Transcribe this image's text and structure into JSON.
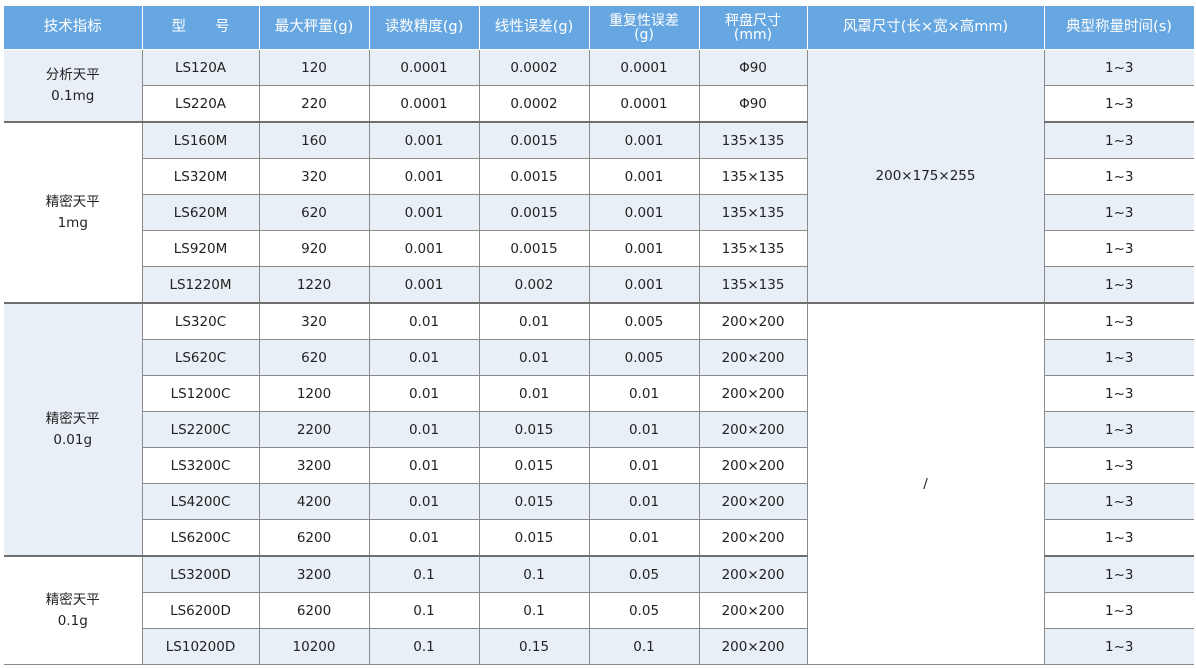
{
  "header": {
    "spec": "技术指标",
    "model": "型　　号",
    "max_capacity": "最大秤量(g)",
    "readability": "读数精度(g)",
    "linearity": "线性误差(g)",
    "repeatability_line1": "重复性误差",
    "repeatability_line2": "(g)",
    "pan_line1": "秤盘尺寸",
    "pan_line2": "(mm)",
    "windshield": "风罩尺寸(长×宽×高mm)",
    "stabilization": "典型称量时间(s)"
  },
  "groups": [
    {
      "name": "分析天平",
      "resolution": "0.1mg",
      "rows": [
        {
          "model": "LS120A",
          "max": "120",
          "readability": "0.0001",
          "linearity": "0.0002",
          "repeatability": "0.0001",
          "pan": "Φ90",
          "time": "1~3"
        },
        {
          "model": "LS220A",
          "max": "220",
          "readability": "0.0001",
          "linearity": "0.0002",
          "repeatability": "0.0001",
          "pan": "Φ90",
          "time": "1~3"
        }
      ]
    },
    {
      "name": "精密天平",
      "resolution": "1mg",
      "rows": [
        {
          "model": "LS160M",
          "max": "160",
          "readability": "0.001",
          "linearity": "0.0015",
          "repeatability": "0.001",
          "pan": "135×135",
          "time": "1~3"
        },
        {
          "model": "LS320M",
          "max": "320",
          "readability": "0.001",
          "linearity": "0.0015",
          "repeatability": "0.001",
          "pan": "135×135",
          "time": "1~3"
        },
        {
          "model": "LS620M",
          "max": "620",
          "readability": "0.001",
          "linearity": "0.0015",
          "repeatability": "0.001",
          "pan": "135×135",
          "time": "1~3"
        },
        {
          "model": "LS920M",
          "max": "920",
          "readability": "0.001",
          "linearity": "0.0015",
          "repeatability": "0.001",
          "pan": "135×135",
          "time": "1~3"
        },
        {
          "model": "LS1220M",
          "max": "1220",
          "readability": "0.001",
          "linearity": "0.002",
          "repeatability": "0.001",
          "pan": "135×135",
          "time": "1~3"
        }
      ]
    },
    {
      "name": "精密天平",
      "resolution": "0.01g",
      "rows": [
        {
          "model": "LS320C",
          "max": "320",
          "readability": "0.01",
          "linearity": "0.01",
          "repeatability": "0.005",
          "pan": "200×200",
          "time": "1~3"
        },
        {
          "model": "LS620C",
          "max": "620",
          "readability": "0.01",
          "linearity": "0.01",
          "repeatability": "0.005",
          "pan": "200×200",
          "time": "1~3"
        },
        {
          "model": "LS1200C",
          "max": "1200",
          "readability": "0.01",
          "linearity": "0.01",
          "repeatability": "0.01",
          "pan": "200×200",
          "time": "1~3"
        },
        {
          "model": "LS2200C",
          "max": "2200",
          "readability": "0.01",
          "linearity": "0.015",
          "repeatability": "0.01",
          "pan": "200×200",
          "time": "1~3"
        },
        {
          "model": "LS3200C",
          "max": "3200",
          "readability": "0.01",
          "linearity": "0.015",
          "repeatability": "0.01",
          "pan": "200×200",
          "time": "1~3"
        },
        {
          "model": "LS4200C",
          "max": "4200",
          "readability": "0.01",
          "linearity": "0.015",
          "repeatability": "0.01",
          "pan": "200×200",
          "time": "1~3"
        },
        {
          "model": "LS6200C",
          "max": "6200",
          "readability": "0.01",
          "linearity": "0.015",
          "repeatability": "0.01",
          "pan": "200×200",
          "time": "1~3"
        }
      ]
    },
    {
      "name": "精密天平",
      "resolution": "0.1g",
      "rows": [
        {
          "model": "LS3200D",
          "max": "3200",
          "readability": "0.1",
          "linearity": "0.1",
          "repeatability": "0.05",
          "pan": "200×200",
          "time": "1~3"
        },
        {
          "model": "LS6200D",
          "max": "6200",
          "readability": "0.1",
          "linearity": "0.1",
          "repeatability": "0.05",
          "pan": "200×200",
          "time": "1~3"
        },
        {
          "model": "LS10200D",
          "max": "10200",
          "readability": "0.1",
          "linearity": "0.15",
          "repeatability": "0.1",
          "pan": "200×200",
          "time": "1~3"
        }
      ]
    }
  ],
  "windshield_values": [
    "200×175×255",
    "/"
  ],
  "colors": {
    "header_bg": "#67a7e1",
    "row_shade": "#e9eff6",
    "border": "#8a8a8a"
  }
}
